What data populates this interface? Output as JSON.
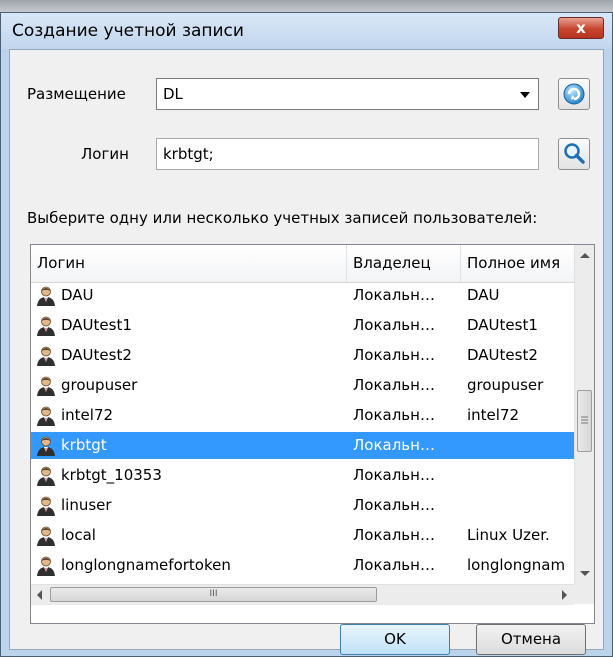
{
  "dialog": {
    "title": "Создание учетной записи",
    "close_label": "x"
  },
  "placement": {
    "label": "Размещение",
    "value": "DL"
  },
  "login": {
    "label": "Логин",
    "value": "krbtgt;"
  },
  "instruction": "Выберите одну или несколько учетных записей пользователей:",
  "table": {
    "columns": [
      "Логин",
      "Владелец",
      "Полное имя"
    ],
    "rows": [
      {
        "login": "DAU",
        "owner": "Локальн…",
        "fullname": "DAU"
      },
      {
        "login": "DAUtest1",
        "owner": "Локальн…",
        "fullname": "DAUtest1"
      },
      {
        "login": "DAUtest2",
        "owner": "Локальн…",
        "fullname": "DAUtest2"
      },
      {
        "login": "groupuser",
        "owner": "Локальн…",
        "fullname": "groupuser"
      },
      {
        "login": "intel72",
        "owner": "Локальн…",
        "fullname": "intel72"
      },
      {
        "login": "krbtgt",
        "owner": "Локальн…",
        "fullname": "",
        "selected": true
      },
      {
        "login": "krbtgt_10353",
        "owner": "Локальн…",
        "fullname": ""
      },
      {
        "login": "linuser",
        "owner": "Локальн…",
        "fullname": ""
      },
      {
        "login": "local",
        "owner": "Локальн…",
        "fullname": "Linux Uzer."
      },
      {
        "login": "longlongnamefortoken",
        "owner": "Локальн…",
        "fullname": "longlongnam"
      }
    ],
    "hscroll_grip": "III"
  },
  "buttons": {
    "ok": "OK",
    "cancel": "Отмена"
  },
  "colors": {
    "selection": "#3399ff",
    "window_frame": "#bcd3ec",
    "close_button": "#c7452f"
  }
}
